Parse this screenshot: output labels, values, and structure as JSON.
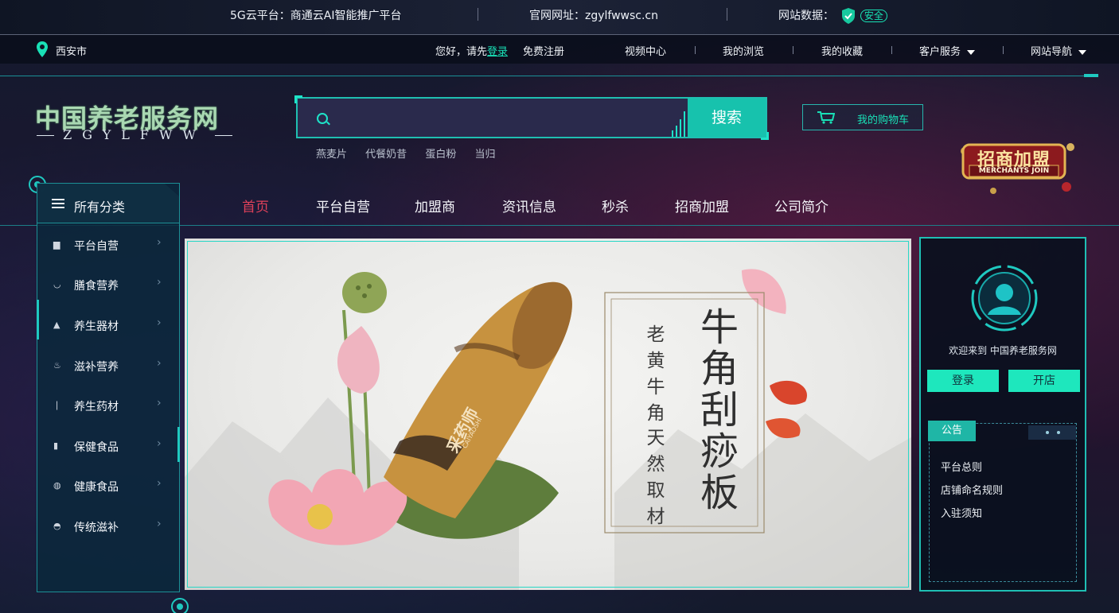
{
  "topbar": {
    "platform": "5G云平台：商通云AI智能推广平台",
    "website": "官网网址：zgylfwwsc.cn",
    "data_label": "网站数据：",
    "safe_label": "安全"
  },
  "userbar": {
    "city": "西安市",
    "greeting": "您好，请先",
    "login": "登录",
    "register": "免费注册",
    "links": [
      "视频中心",
      "我的浏览",
      "我的收藏",
      "客户服务",
      "网站导航"
    ]
  },
  "logo": {
    "title": "中国养老服务网",
    "subtitle": "ZGYLFWW"
  },
  "search": {
    "placeholder": "",
    "button": "搜索",
    "hot_words": [
      "燕麦片",
      "代餐奶昔",
      "蛋白粉",
      "当归"
    ]
  },
  "cart": {
    "label": "我的购物车"
  },
  "join_badge": {
    "line1": "招商加盟",
    "line2": "MERCHANTS JOIN"
  },
  "main_nav": [
    "首页",
    "平台自营",
    "加盟商",
    "资讯信息",
    "秒杀",
    "招商加盟",
    "公司简介"
  ],
  "sidebar": {
    "title": "所有分类",
    "items": [
      "平台自营",
      "膳食营养",
      "养生器材",
      "滋补营养",
      "养生药材",
      "保健食品",
      "健康食品",
      "传统滋补"
    ]
  },
  "banner": {
    "headline": "牛角刮痧板",
    "tagline_col1": "老黄牛角",
    "tagline_col2": "天然取材",
    "brand_cn": "采药师",
    "brand_en": "CAIYAOSHI"
  },
  "user_panel": {
    "welcome": "欢迎来到 中国养老服务网",
    "login": "登录",
    "open_store": "开店",
    "notice_tab": "公告",
    "notices": [
      "平台总则",
      "店铺命名规则",
      "入驻须知"
    ]
  },
  "colors": {
    "accent": "#1ee7bd",
    "nav_active": "#e0415a",
    "frame": "#1fbfb4"
  }
}
